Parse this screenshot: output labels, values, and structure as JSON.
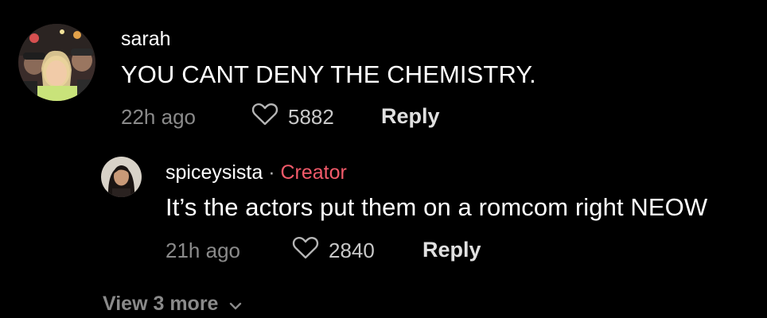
{
  "comment": {
    "avatar": "user-photo-avatar",
    "username": "sarah",
    "text": "YOU CANT DENY THE CHEMISTRY.",
    "time": "22h ago",
    "likes": "5882",
    "reply_label": "Reply"
  },
  "reply": {
    "avatar": "user-photo-avatar",
    "username": "spiceysista",
    "separator": "·",
    "badge": "Creator",
    "text": "It’s the actors put them on a romcom right NEOW",
    "time": "21h ago",
    "likes": "2840",
    "reply_label": "Reply"
  },
  "view_more": {
    "label": "View 3 more",
    "icon": "chevron-down-icon"
  },
  "colors": {
    "background": "#000000",
    "text_primary": "#ffffff",
    "text_secondary": "#8a8a8a",
    "creator_badge": "#f25a6a"
  }
}
